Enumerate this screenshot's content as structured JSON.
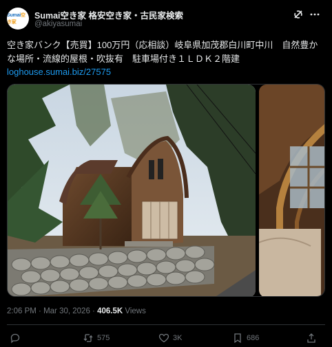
{
  "author": {
    "avatar_text": "Sumai",
    "avatar_text_accent": "空き家",
    "name": "Sumai空き家 格安空き家・古民家検索",
    "handle": "@akiyasumai"
  },
  "post": {
    "text": "空き家バンク【売買】100万円（応相談）岐阜県加茂郡白川町中川　自然豊かな場所・流線的屋根・吹抜有　駐車場付き１ＬＤＫ２階建",
    "link": "loghouse.sumai.biz/27575"
  },
  "meta": {
    "time": "2:06 PM",
    "separator": "·",
    "date": "Mar 30, 2026",
    "views_count": "406.5K",
    "views_label": "Views"
  },
  "actions": {
    "replies": "",
    "reposts": "575",
    "likes": "3K",
    "bookmarks": "686"
  },
  "icons": [
    "grok-icon",
    "more-icon",
    "reply-icon",
    "repost-icon",
    "like-icon",
    "bookmark-icon",
    "share-icon"
  ],
  "colors": {
    "background": "#000000",
    "text": "#e7e9ea",
    "muted": "#71767b",
    "link": "#1d9bf0",
    "border": "#2f3336"
  }
}
